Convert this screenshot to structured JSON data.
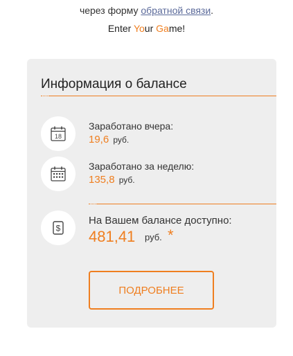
{
  "intro": {
    "prefix": "через форму ",
    "link": "обратной связи",
    "suffix": "."
  },
  "tagline": {
    "p1": "Enter ",
    "p2": "Yo",
    "p3": "ur ",
    "p4": "Ga",
    "p5": "me!"
  },
  "balance_card": {
    "title": "Информация о балансе",
    "yesterday": {
      "label": "Заработано вчера:",
      "value": "19,6",
      "unit": "руб.",
      "icon": "calendar-day-icon",
      "icon_text": "18"
    },
    "week": {
      "label": "Заработано за неделю:",
      "value": "135,8",
      "unit": "руб.",
      "icon": "calendar-week-icon"
    },
    "available": {
      "label": "На Вашем балансе доступно:",
      "value": "481,41",
      "unit": "руб.",
      "star": "*",
      "icon": "dollar-bill-icon"
    },
    "more_button": "ПОДРОБНЕЕ"
  },
  "colors": {
    "accent": "#ef7e1f",
    "card_bg": "#eeeeee",
    "link": "#5b6a9a"
  }
}
